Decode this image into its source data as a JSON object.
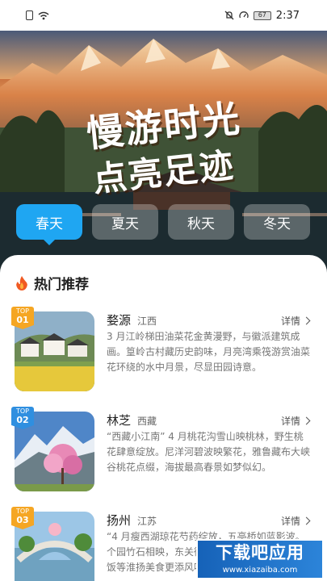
{
  "status": {
    "battery": "67",
    "time": "2:37"
  },
  "hero": {
    "line1": "慢游时光",
    "line2": "点亮足迹"
  },
  "tabs": [
    {
      "label": "春天",
      "active": true
    },
    {
      "label": "夏天",
      "active": false
    },
    {
      "label": "秋天",
      "active": false
    },
    {
      "label": "冬天",
      "active": false
    }
  ],
  "section": {
    "title": "热门推荐"
  },
  "items": [
    {
      "badge_top": "TOP",
      "rank": "01",
      "name": "婺源",
      "region": "江西",
      "detail": "详情",
      "desc": "3 月江岭梯田油菜花金黄漫野，与徽派建筑成画。篁岭古村藏历史韵味，月亮湾乘筏游赏油菜花环绕的水中月景，尽显田园诗意。"
    },
    {
      "badge_top": "TOP",
      "rank": "02",
      "name": "林芝",
      "region": "西藏",
      "detail": "详情",
      "desc": "“西藏小江南” 4 月桃花沟雪山映桃林，野生桃花肆意绽放。尼洋河碧波映繁花，雅鲁藏布大峡谷桃花点缀，海拔最高春景如梦似幻。"
    },
    {
      "badge_top": "TOP",
      "rank": "03",
      "name": "扬州",
      "region": "江苏",
      "detail": "详情",
      "desc": "“4 月瘦西湖琼花芍药绽放，五亭桥如蓝影波。个园竹石相映，东关街人流涌动，枝头、扬州炒饭等淮扬美食更添风味。"
    }
  ],
  "watermark": {
    "main": "下载吧应用",
    "sub": "www.xiazaiba.com"
  }
}
